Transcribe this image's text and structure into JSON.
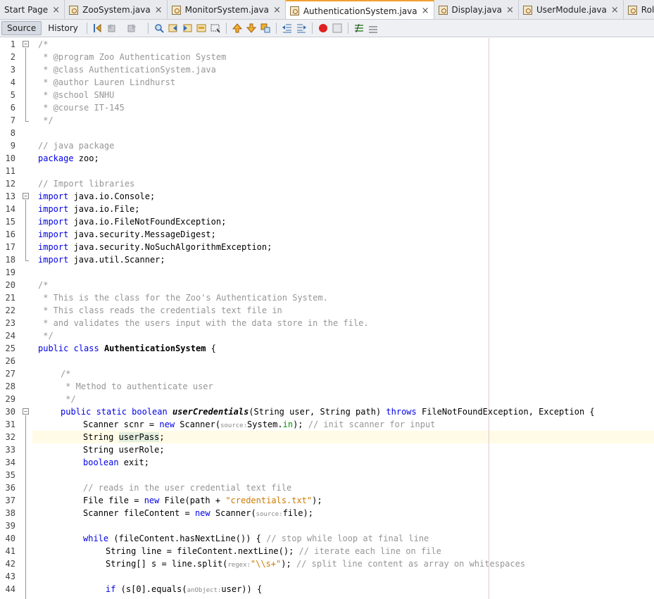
{
  "tabs": [
    {
      "label": "Start Page",
      "active": false,
      "icon": false
    },
    {
      "label": "ZooSystem.java",
      "active": false,
      "icon": true
    },
    {
      "label": "MonitorSystem.java",
      "active": false,
      "icon": true
    },
    {
      "label": "AuthenticationSystem.java",
      "active": true,
      "icon": true
    },
    {
      "label": "Display.java",
      "active": false,
      "icon": true
    },
    {
      "label": "UserModule.java",
      "active": false,
      "icon": true
    },
    {
      "label": "Roles.java",
      "active": false,
      "icon": true
    }
  ],
  "close_glyph": "×",
  "toolbar": {
    "source_label": "Source",
    "history_label": "History"
  },
  "line_numbers": [
    "1",
    "2",
    "3",
    "4",
    "5",
    "6",
    "7",
    "8",
    "9",
    "10",
    "11",
    "12",
    "13",
    "14",
    "15",
    "16",
    "17",
    "18",
    "19",
    "20",
    "21",
    "22",
    "23",
    "24",
    "25",
    "26",
    "27",
    "28",
    "29",
    "30",
    "31",
    "32",
    "33",
    "34",
    "35",
    "36",
    "37",
    "38",
    "39",
    "40",
    "41",
    "42",
    "43",
    "44"
  ],
  "code": {
    "l1": "/*",
    "l2": " * @program Zoo Authentication System",
    "l3": " * @class AuthenticationSystem.java",
    "l4": " * @author Lauren Lindhurst",
    "l5": " * @school SNHU",
    "l6": " * @course IT-145",
    "l7": " */",
    "l9": "// java package",
    "l10_kw": "package",
    "l10_rest": " zoo;",
    "l12": "// Import libraries",
    "import_kw": "import",
    "l13": " java.io.Console;",
    "l14": " java.io.File;",
    "l15": " java.io.FileNotFoundException;",
    "l16": " java.security.MessageDigest;",
    "l17": " java.security.NoSuchAlgorithmException;",
    "l18": " java.util.Scanner;",
    "l20": "/*",
    "l21": " * This is the class for the Zoo's Authentication System.",
    "l22": " * This class reads the credentials text file in",
    "l23": " * and validates the users input with the data store in the file.",
    "l24": " */",
    "l25_kw": "public class",
    "l25_name": "AuthenticationSystem",
    "l25_rest": " {",
    "l27": "/*",
    "l28": " * Method to authenticate user",
    "l29": " */",
    "l30_kw": "public static boolean",
    "l30_name": "userCredentials",
    "l30_mid": "(String user, String path) ",
    "l30_kw2": "throws",
    "l30_rest": " FileNotFoundException, Exception {",
    "l31_a": "Scanner scnr = ",
    "new_kw": "new",
    "l31_b": " Scanner(",
    "l31_hint": "source:",
    "l31_c": "System.",
    "l31_field": "in",
    "l31_d": "); ",
    "l31_cm": "// init scanner for input",
    "l32_a": "String ",
    "l32_var": "userPass",
    "l32_b": ";",
    "l33": "String userRole;",
    "l34_kw": "boolean",
    "l34_rest": " exit;",
    "l36": "// reads in the user credential text file",
    "l37_a": "File file = ",
    "l37_b": " File(path + ",
    "l37_str": "\"credentials.txt\"",
    "l37_c": ");",
    "l38_a": "Scanner fileContent = ",
    "l38_b": " Scanner(",
    "l38_hint": "source:",
    "l38_c": "file);",
    "l40_kw": "while",
    "l40_a": " (fileContent.hasNextLine()) { ",
    "l40_cm": "// stop while loop at final line",
    "l41_a": "String line = fileContent.nextLine(); ",
    "l41_cm": "// iterate each line on file",
    "l42_a": "String[] s = line.split(",
    "l42_hint": "regex:",
    "l42_str": "\"\\\\s+\"",
    "l42_b": "); ",
    "l42_cm": "// split line content as array on whitespaces",
    "l44_kw": "if",
    "l44_a": " (s[0].equals(",
    "l44_hint": "anObject:",
    "l44_b": "user)) {"
  }
}
